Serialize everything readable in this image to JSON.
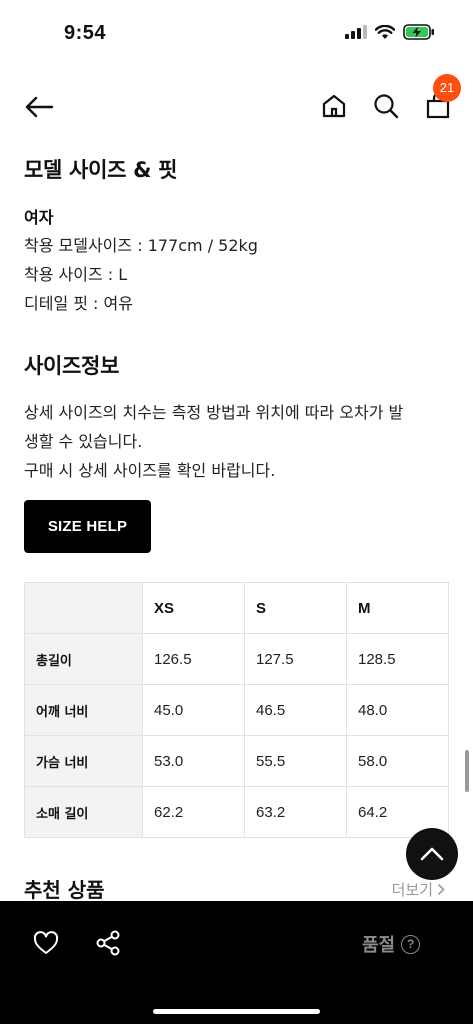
{
  "status": {
    "time": "9:54"
  },
  "nav": {
    "cart_count": "21"
  },
  "model": {
    "title": "모델 사이즈 & 핏",
    "gender": "여자",
    "lines": [
      "착용 모델사이즈 : 177cm / 52kg",
      "착용 사이즈 : L",
      "디테일 핏 : 여유"
    ]
  },
  "size_info": {
    "title": "사이즈정보",
    "desc_line1": "상세 사이즈의 치수는 측정 방법과 위치에 따라 오차가 발",
    "desc_line2": "생할 수 있습니다.",
    "desc_line3": "구매 시 상세 사이즈를 확인 바랍니다.",
    "help_button": "SIZE HELP"
  },
  "size_table": {
    "columns": [
      "XS",
      "S",
      "M"
    ],
    "rows": [
      {
        "label": "총길이",
        "values": [
          "126.5",
          "127.5",
          "128.5"
        ]
      },
      {
        "label": "어깨 너비",
        "values": [
          "45.0",
          "46.5",
          "48.0"
        ]
      },
      {
        "label": "가슴 너비",
        "values": [
          "53.0",
          "55.5",
          "58.0"
        ]
      },
      {
        "label": "소매 길이",
        "values": [
          "62.2",
          "63.2",
          "64.2"
        ]
      }
    ]
  },
  "recommend": {
    "title": "추천 상품",
    "more_label": "더보기"
  },
  "bottom": {
    "sold_out_label": "품절",
    "help_glyph": "?"
  },
  "colors": {
    "accent_badge": "#ff4f0e",
    "bottom_bar": "#000000",
    "disabled_text": "#8a8a8a"
  }
}
